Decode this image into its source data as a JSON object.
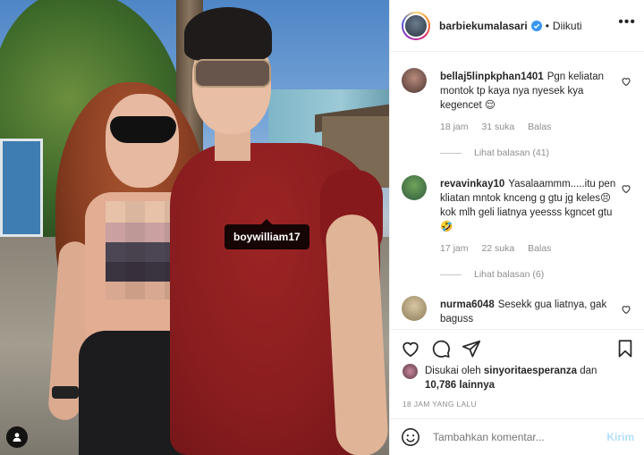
{
  "post": {
    "photo_tag": "boywilliam17"
  },
  "header": {
    "username": "barbiekumalasari",
    "separator": "•",
    "follow_label": "Diikuti"
  },
  "comments": [
    {
      "username": "bellaj5linpkphan1401",
      "text": "Pgn keliatan montok tp kaya nya nyesek kya kegencet 😌",
      "time": "18 jam",
      "likes": "31 suka",
      "reply_label": "Balas",
      "view_replies": "Lihat balasan (41)"
    },
    {
      "username": "revavinkay10",
      "text": "Yasalaammm.....itu pen kliatan mntok knceng g gtu jg keles😣kok mlh geli liatnya yeesss kgncet gtu🤣",
      "time": "17 jam",
      "likes": "22 suka",
      "reply_label": "Balas",
      "view_replies": "Lihat balasan (6)"
    },
    {
      "username": "nurma6048",
      "text": "Sesekk gua liatnya, gak baguss"
    }
  ],
  "likes": {
    "prefix": "Disukai oleh",
    "user": "sinyoritaesperanza",
    "connector": "dan",
    "count": "10,786 lainnya"
  },
  "timestamp": "18 JAM YANG LALU",
  "composer": {
    "placeholder": "Tambahkan komentar...",
    "send_label": "Kirim"
  },
  "colors": {
    "verified": "#3897f0",
    "send_disabled": "#b2dffc",
    "muted_text": "#8e8e8e"
  },
  "icons": [
    "verified-badge-icon",
    "more-options-icon",
    "heart-icon",
    "comment-icon",
    "share-icon",
    "bookmark-icon",
    "emoji-icon",
    "person-tag-icon"
  ]
}
